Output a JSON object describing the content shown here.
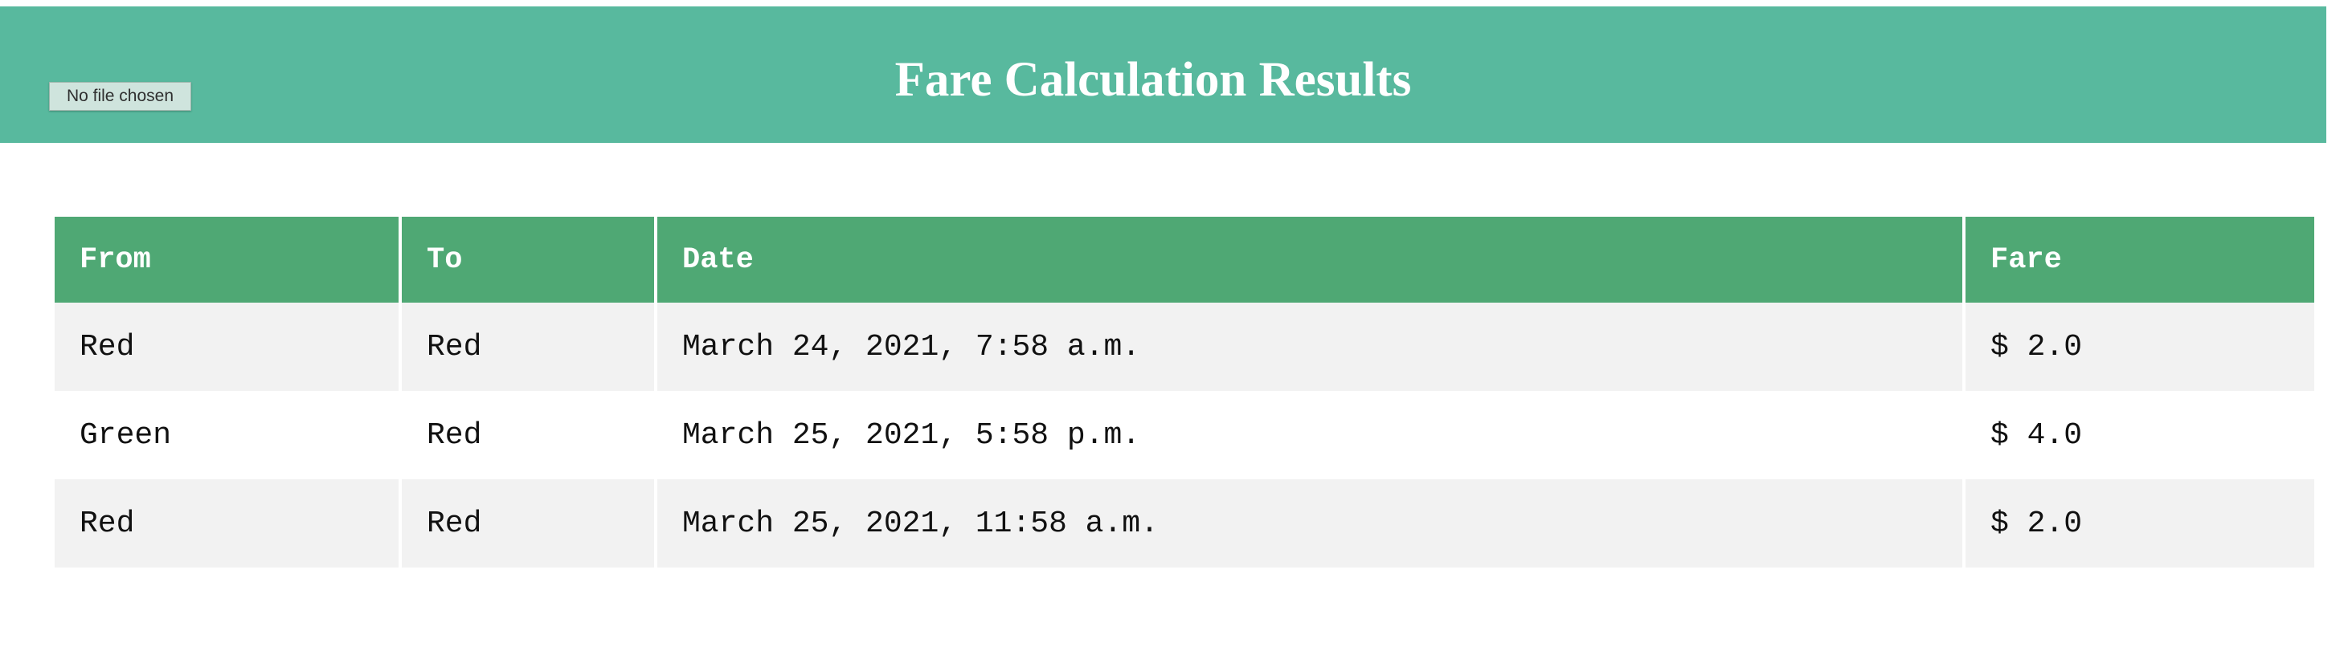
{
  "header": {
    "title": "Fare Calculation Results",
    "file_input_label": "No file chosen"
  },
  "colors": {
    "header_bg": "#58b99e",
    "table_header_bg": "#4fa874",
    "row_alt_bg": "#f2f2f2"
  },
  "table": {
    "columns": [
      "From",
      "To",
      "Date",
      "Fare"
    ],
    "rows": [
      {
        "from": "Red",
        "to": "Red",
        "date": "March 24, 2021, 7:58 a.m.",
        "fare": "$ 2.0"
      },
      {
        "from": "Green",
        "to": "Red",
        "date": "March 25, 2021, 5:58 p.m.",
        "fare": "$ 4.0"
      },
      {
        "from": "Red",
        "to": "Red",
        "date": "March 25, 2021, 11:58 a.m.",
        "fare": "$ 2.0"
      }
    ]
  }
}
